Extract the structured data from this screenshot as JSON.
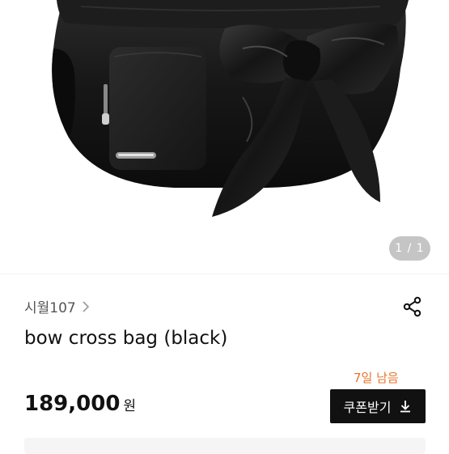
{
  "gallery": {
    "image_alt": "bow cross bag (black)",
    "page_indicator": "1 / 1"
  },
  "seller": {
    "name": "시월107"
  },
  "product": {
    "title": "bow cross bag (black)",
    "days_left": "7일 남음",
    "price": "189,000",
    "price_unit": "원"
  },
  "actions": {
    "coupon_label": "쿠폰받기"
  },
  "icons": {
    "seller_chevron": "chevron-right-icon",
    "share": "share-icon",
    "coupon": "download-icon"
  },
  "colors": {
    "accent_orange": "#e8742c",
    "button_bg": "#111111",
    "bag": "#141414"
  }
}
